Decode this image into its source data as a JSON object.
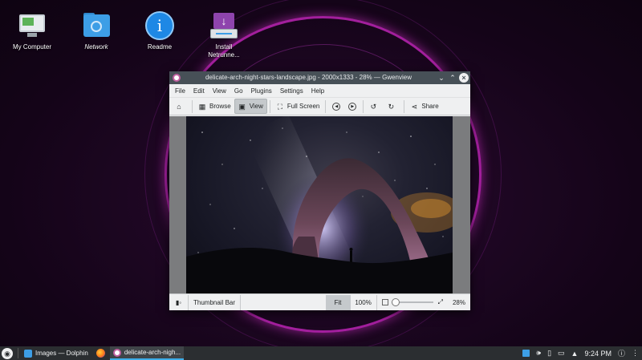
{
  "desktop": {
    "icons": [
      {
        "label": "My Computer",
        "icon": "computer-icon"
      },
      {
        "label": "Network",
        "icon": "network-folder-icon"
      },
      {
        "label": "Readme",
        "icon": "info-icon"
      },
      {
        "label": "Install\nNetrunne...",
        "icon": "install-icon"
      }
    ]
  },
  "window": {
    "title": "delicate-arch-night-stars-landscape.jpg - 2000x1333 - 28% — Gwenview",
    "menu": [
      "File",
      "Edit",
      "View",
      "Go",
      "Plugins",
      "Settings",
      "Help"
    ],
    "toolbar": {
      "browse": "Browse",
      "view": "View",
      "fullscreen": "Full Screen",
      "share": "Share"
    },
    "statusbar": {
      "thumbnail_bar": "Thumbnail Bar",
      "fit": "Fit",
      "zoom_100": "100%",
      "zoom_pct": "28%",
      "zoom_slider_level": 0.0
    }
  },
  "taskbar": {
    "tasks": [
      {
        "label": "Images — Dolphin",
        "icon": "dolphin-icon"
      },
      {
        "label": "",
        "icon": "firefox-icon"
      },
      {
        "label": "delicate-arch-nigh...",
        "icon": "gwenview-icon"
      }
    ],
    "clock": "9:24 PM"
  },
  "colors": {
    "titlebar": "#475057",
    "taskbar": "#2b2e31",
    "accent": "#3daee9",
    "ring": "#d228c8"
  }
}
